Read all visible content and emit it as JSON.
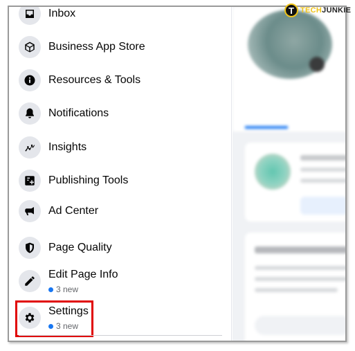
{
  "sidebar": {
    "items": [
      {
        "label": "Inbox",
        "icon": "inbox-icon"
      },
      {
        "label": "Business App Store",
        "icon": "cube-icon"
      },
      {
        "label": "Resources & Tools",
        "icon": "info-icon"
      },
      {
        "label": "Notifications",
        "icon": "bell-icon"
      },
      {
        "label": "Insights",
        "icon": "insights-icon"
      },
      {
        "label": "Publishing Tools",
        "icon": "publishing-icon"
      },
      {
        "label": "Ad Center",
        "icon": "megaphone-icon"
      },
      {
        "label": "Page Quality",
        "icon": "shield-icon"
      },
      {
        "label": "Edit Page Info",
        "icon": "pencil-icon",
        "badge": "3 new"
      },
      {
        "label": "Settings",
        "icon": "gear-icon",
        "badge": "3 new"
      }
    ]
  },
  "watermark": {
    "brand_a": "TECH",
    "brand_b": "JUNKIE",
    "mark": "T"
  },
  "colors": {
    "accent": "#1877f2",
    "highlight": "#e00000",
    "icon_bg": "#e4e6eb"
  }
}
